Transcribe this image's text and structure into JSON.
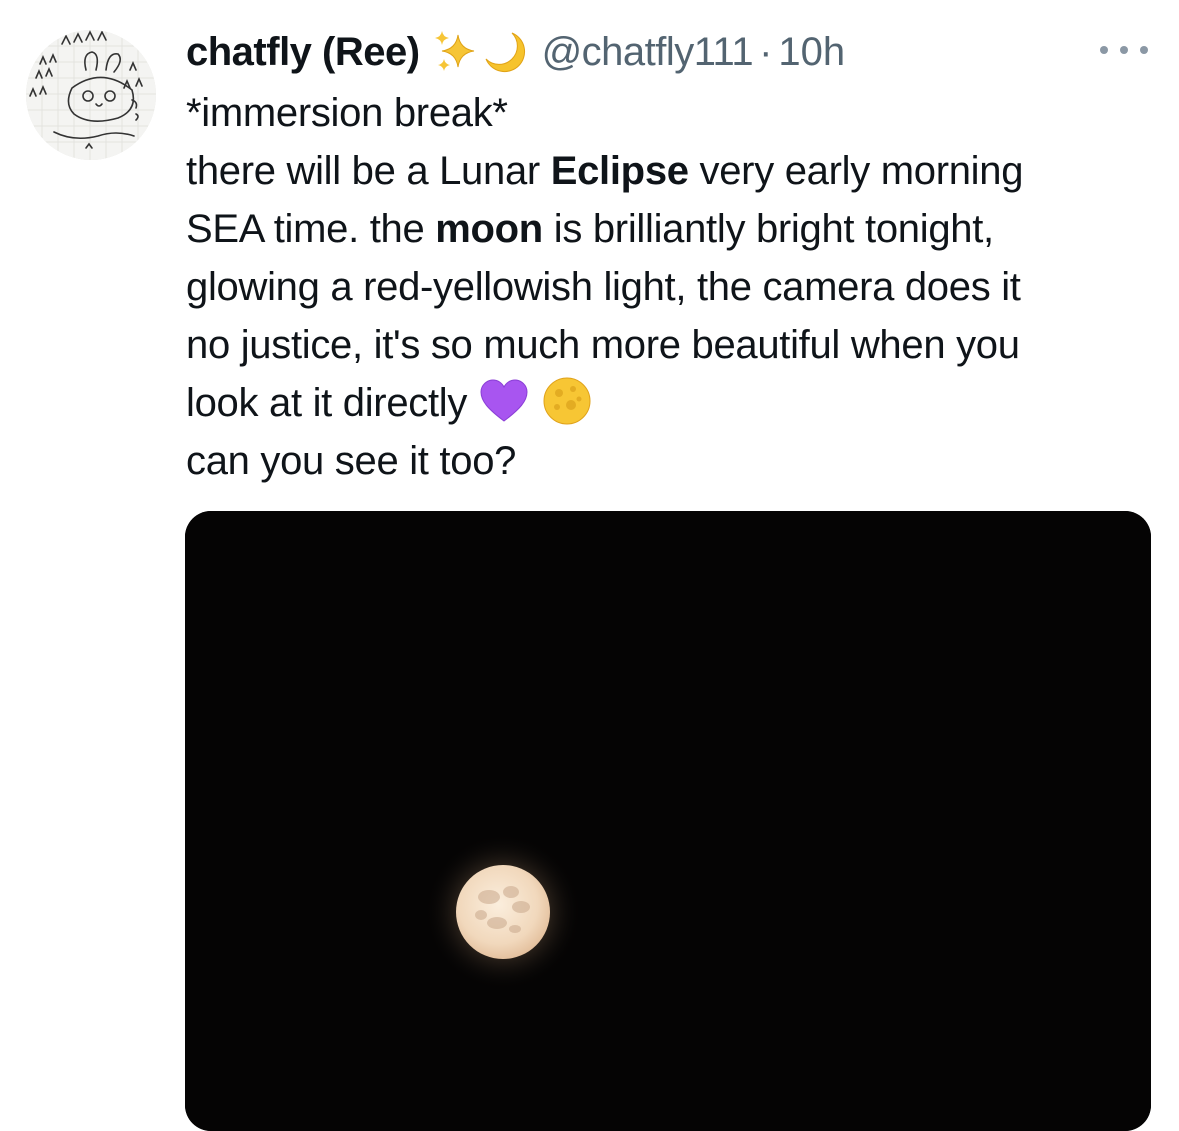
{
  "tweet": {
    "author": {
      "display_name": "chatfly (Ree)",
      "name_emojis": [
        "sparkles-icon",
        "crescent-moon-icon"
      ],
      "handle": "@chatfly111",
      "separator": "·",
      "timestamp": "10h"
    },
    "more_menu_icon": "ellipsis-icon",
    "text_lines": [
      [
        "*immersion break*"
      ],
      [
        "there will be a Lunar ",
        "Eclipse",
        " very early morning"
      ],
      [
        "SEA time. the ",
        "moon",
        " is brilliantly bright tonight,"
      ],
      [
        "glowing a red-yellowish light, the camera does it"
      ],
      [
        "no justice, it's so much more beautiful when you"
      ],
      [
        "look at it directly"
      ],
      [
        "can you see it too?"
      ]
    ],
    "text_emojis": [
      "purple-heart-icon",
      "full-moon-icon"
    ],
    "media": {
      "type": "photo",
      "subject": "full-moon-night-sky"
    }
  },
  "colors": {
    "text_primary": "#0f1419",
    "text_secondary": "#536471",
    "media_background": "#050404",
    "moon": "#f4dcc0"
  }
}
